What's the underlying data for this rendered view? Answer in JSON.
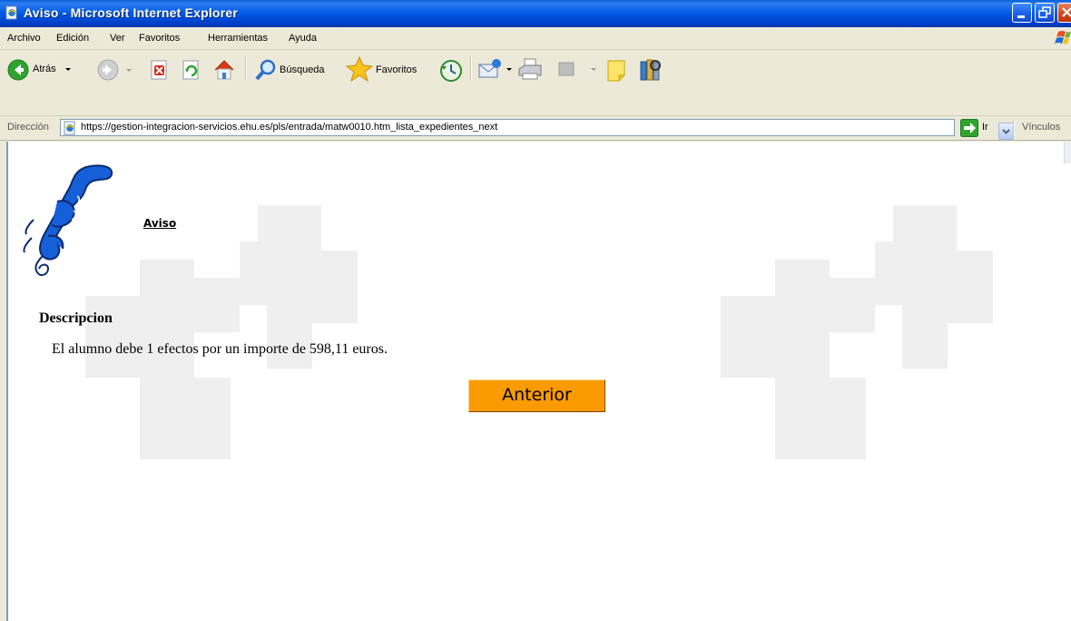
{
  "window": {
    "title": "Aviso - Microsoft Internet Explorer"
  },
  "menu": {
    "items": [
      "Archivo",
      "Edición",
      "Ver",
      "Favoritos",
      "Herramientas",
      "Ayuda"
    ]
  },
  "toolbar": {
    "back_label": "Atrás",
    "search_label": "Búsqueda",
    "favorites_label": "Favoritos"
  },
  "address": {
    "label": "Dirección",
    "url": "https://gestion-integracion-servicios.ehu.es/pls/entrada/matw0010.htm_lista_expedientes_next",
    "go_label": "Ir",
    "links_label": "Vínculos"
  },
  "page": {
    "aviso_link": "Aviso",
    "heading": "Descripcion",
    "message": "El alumno debe 1 efectos por un importe de 598,11 euros.",
    "button_label": "Anterior"
  },
  "colors": {
    "titlebar": "#0058e6",
    "button_orange": "#f99b00",
    "logo_blue": "#1560d8",
    "watermark_gray": "#efefef"
  }
}
